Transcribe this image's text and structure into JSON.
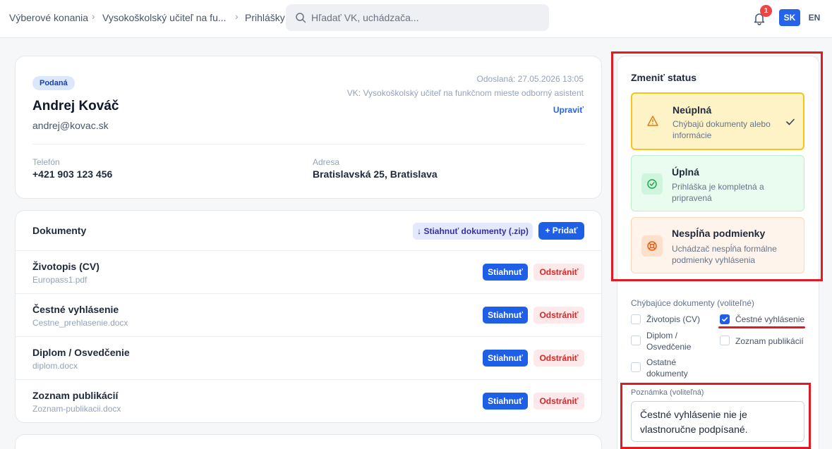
{
  "breadcrumb": {
    "items": [
      "Výberové konania",
      "Vysokoškolský učiteľ na fu...",
      "Prihlášky"
    ],
    "separator": "›"
  },
  "search": {
    "placeholder": "Hľadať VK, uchádzača..."
  },
  "notifications": {
    "count": "1"
  },
  "languages": {
    "active": "SK",
    "other": "EN"
  },
  "applicant": {
    "status": "Podaná",
    "name": "Andrej Kováč",
    "email": "andrej@kovac.sk",
    "sent": "Odoslaná: 27.05.2026 13:05",
    "vk": "VK: Vysokoškolský učiteľ na funkčnom mieste odborný asistent",
    "edit_label": "Upraviť",
    "phone_label": "Telefón",
    "phone": "+421 903 123 456",
    "address_label": "Adresa",
    "address": "Bratislavská 25, Bratislava"
  },
  "documents": {
    "title": "Dokumenty",
    "zip_label": "↓ Stiahnuť dokumenty (.zip)",
    "add_label": "+ Pridať",
    "download_label": "Stiahnuť",
    "remove_label": "Odstrániť",
    "items": [
      {
        "name": "Životopis (CV)",
        "file": "Europass1.pdf"
      },
      {
        "name": "Čestné vyhlásenie",
        "file": "Cestne_prehlasenie.docx"
      },
      {
        "name": "Diplom / Osvedčenie",
        "file": "diplom.docx"
      },
      {
        "name": "Zoznam publikácií",
        "file": "Zoznam-publikacii.docx"
      }
    ]
  },
  "status_panel": {
    "title": "Zmeniť status",
    "options": [
      {
        "title": "Neúplná",
        "desc": "Chýbajú dokumenty alebo informácie",
        "icon": "warning-icon",
        "selected": true,
        "color": "#f59e0b"
      },
      {
        "title": "Úplná",
        "desc": "Prihláška je kompletná a pripravená",
        "icon": "check-circle-icon",
        "selected": false,
        "color": "#22c55e"
      },
      {
        "title": "Nespĺňa podmienky",
        "desc": "Uchádzač nespĺňa formálne podmienky vyhlásenia",
        "icon": "lifebuoy-icon",
        "selected": false,
        "color": "#f97316"
      }
    ]
  },
  "missing_docs": {
    "label": "Chýbajúce dokumenty (voliteľné)",
    "items": [
      {
        "label": "Životopis (CV)",
        "checked": false
      },
      {
        "label": "Čestné vyhlásenie",
        "checked": true
      },
      {
        "label": "Diplom / Osvedčenie",
        "checked": false
      },
      {
        "label": "Zoznam publikácií",
        "checked": false
      },
      {
        "label": "Ostatné dokumenty",
        "checked": false
      }
    ]
  },
  "note": {
    "label": "Poznámka (voliteľná)",
    "value": "Čestné vyhlásenie nie je vlastnoručne podpísané."
  }
}
